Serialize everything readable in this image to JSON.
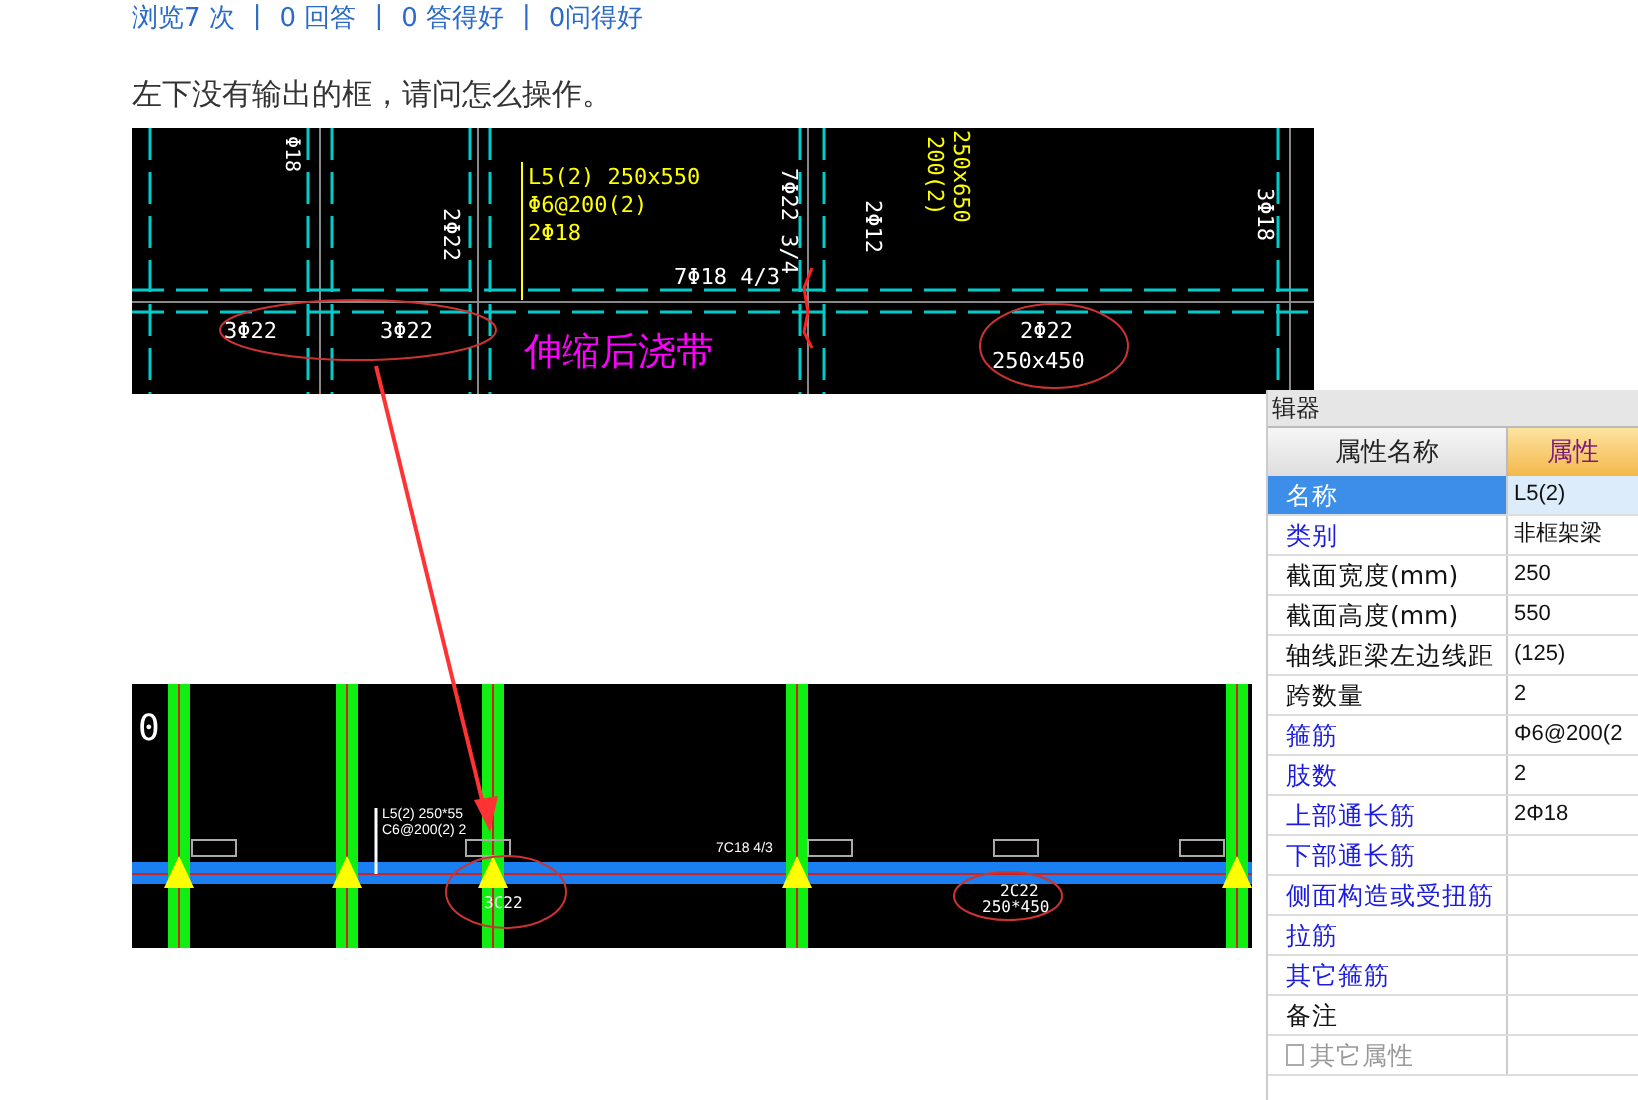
{
  "stats": [
    {
      "text": "浏览7 次"
    },
    {
      "text": "0 回答"
    },
    {
      "text": "0 答得好"
    },
    {
      "text": "0问得好"
    }
  ],
  "separator": "|",
  "question": "左下没有输出的框，请问怎么操作。",
  "top_drawing": {
    "labels": [
      {
        "text": "Φ18"
      },
      {
        "text": "L5(2) 250x550"
      },
      {
        "text": "Φ6@200(2)"
      },
      {
        "text": "2Φ18"
      },
      {
        "text": "2Φ22"
      },
      {
        "text": "7Φ22 3/4"
      },
      {
        "text": "2Φ12"
      },
      {
        "text": "7Φ18 4/3"
      },
      {
        "text": "200(2)"
      },
      {
        "text": "250x650"
      },
      {
        "text": "3Φ18"
      },
      {
        "text": "3Φ22"
      },
      {
        "text": "3Φ22"
      },
      {
        "text": "伸缩后浇带"
      },
      {
        "text": "2Φ22"
      },
      {
        "text": "250x450"
      }
    ]
  },
  "bottom_drawing": {
    "labels": [
      {
        "text": "0"
      },
      {
        "text": "L5(2) 250*55"
      },
      {
        "text": "C6@200(2) 2"
      },
      {
        "text": "7C18 4/3"
      },
      {
        "text": "3C22"
      },
      {
        "text": "2C22"
      },
      {
        "text": "250*450"
      }
    ]
  },
  "panel": {
    "title": "辑器",
    "columns": [
      "属性名称",
      "属性"
    ],
    "rows": [
      {
        "name": "名称",
        "value": "L5(2)",
        "kind": "public",
        "selected": true
      },
      {
        "name": "类别",
        "value": "非框架梁",
        "kind": "public",
        "selected": false
      },
      {
        "name": "截面宽度(mm)",
        "value": "250",
        "kind": "private",
        "selected": false
      },
      {
        "name": "截面高度(mm)",
        "value": "550",
        "kind": "private",
        "selected": false
      },
      {
        "name": "轴线距梁左边线距",
        "value": "(125)",
        "kind": "private",
        "selected": false
      },
      {
        "name": "跨数量",
        "value": "2",
        "kind": "private",
        "selected": false
      },
      {
        "name": "箍筋",
        "value": "Φ6@200(2",
        "kind": "public",
        "selected": false
      },
      {
        "name": "肢数",
        "value": "2",
        "kind": "public",
        "selected": false
      },
      {
        "name": "上部通长筋",
        "value": "2Φ18",
        "kind": "public",
        "selected": false
      },
      {
        "name": "下部通长筋",
        "kind": "public",
        "selected": false
      },
      {
        "name": "侧面构造或受扭筋",
        "kind": "public",
        "selected": false
      },
      {
        "name": "拉筋",
        "kind": "public",
        "selected": false
      },
      {
        "name": "其它箍筋",
        "kind": "public",
        "selected": false
      },
      {
        "name": "备注",
        "kind": "private",
        "selected": false
      },
      {
        "name": "其它属性",
        "kind": "group",
        "selected": false
      }
    ]
  }
}
